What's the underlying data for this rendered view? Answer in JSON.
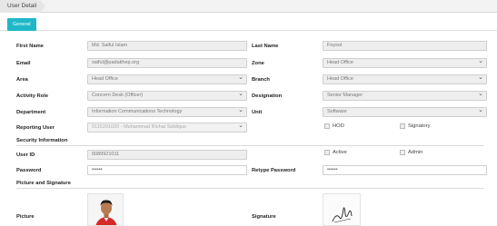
{
  "breadcrumb": "User Detail",
  "tab": "General",
  "labels": {
    "first_name": "First Name",
    "last_name": "Last Name",
    "email": "Email",
    "zone": "Zone",
    "area": "Area",
    "branch": "Branch",
    "activity_role": "Activity Role",
    "designation": "Designation",
    "department": "Department",
    "unit": "Unit",
    "reporting_user": "Reporting User",
    "user_id": "User ID",
    "password": "Password",
    "retype_password": "Retype Password",
    "picture": "Picture",
    "signature": "Signature"
  },
  "values": {
    "first_name": "Md. Saiful Islam",
    "last_name": "Foysol",
    "email": "saiful@padakhep.org",
    "zone": "Head Office",
    "area": "Head Office",
    "branch": "Head Office",
    "activity_role": "Concern Desk (Officer)",
    "designation": "Senior Manager",
    "department": "Information Communications Technology",
    "unit": "Software",
    "reporting_user": "0115201020 - Muhammad Rivhat Siddique",
    "user_id": "0089921011",
    "password": "••••••",
    "retype_password": "••••••"
  },
  "checkboxes": {
    "hod": "HOD",
    "signatory": "Signatory",
    "active": "Active",
    "admin": "Admin"
  },
  "sections": {
    "security": "Security Information",
    "picture": "Picture and Signature"
  },
  "icons": [
    "chevron-down-icon",
    "avatar-photo",
    "signature-image"
  ]
}
